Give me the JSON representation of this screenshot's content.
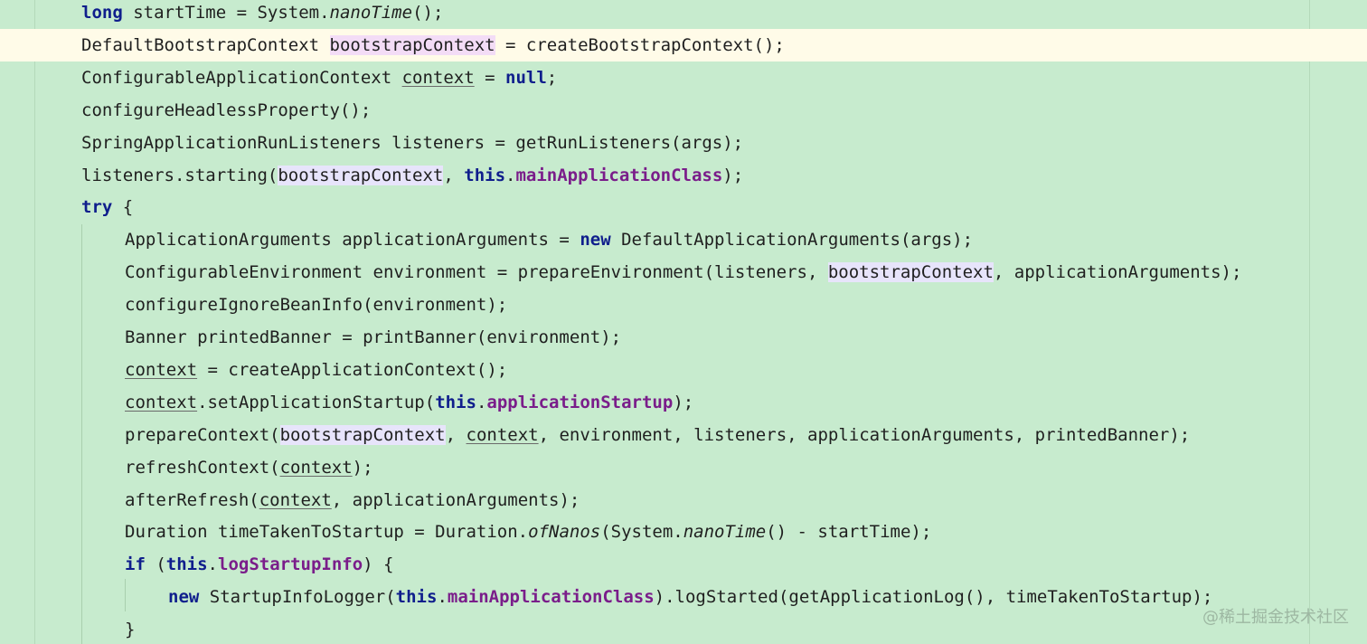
{
  "editor": {
    "lines": [
      {
        "indent": 1,
        "current": false,
        "tokens": [
          {
            "t": "long",
            "s": "kw"
          },
          {
            "t": " startTime = System."
          },
          {
            "t": "nanoTime",
            "s": "ital"
          },
          {
            "t": "();"
          }
        ]
      },
      {
        "indent": 1,
        "current": true,
        "tokens": [
          {
            "t": "DefaultBootstrapContext "
          },
          {
            "t": "bootstra",
            "s": "hl-caret"
          },
          {
            "caret": true
          },
          {
            "t": "pContext",
            "s": "hl-caret"
          },
          {
            "t": " = createBootstrapContext();"
          }
        ]
      },
      {
        "indent": 1,
        "current": false,
        "tokens": [
          {
            "t": "ConfigurableApplicationContext "
          },
          {
            "t": "context",
            "s": "ul"
          },
          {
            "t": " = "
          },
          {
            "t": "null",
            "s": "kw"
          },
          {
            "t": ";"
          }
        ]
      },
      {
        "indent": 1,
        "current": false,
        "tokens": [
          {
            "t": "configureHeadlessProperty();"
          }
        ]
      },
      {
        "indent": 1,
        "current": false,
        "tokens": [
          {
            "t": "SpringApplicationRunListeners listeners = getRunListeners(args);"
          }
        ]
      },
      {
        "indent": 1,
        "current": false,
        "tokens": [
          {
            "t": "listeners.starting("
          },
          {
            "t": "bootstrapContext",
            "s": "hl"
          },
          {
            "t": ", "
          },
          {
            "t": "this",
            "s": "kw"
          },
          {
            "t": "."
          },
          {
            "t": "mainApplicationClass",
            "s": "fld"
          },
          {
            "t": ");"
          }
        ]
      },
      {
        "indent": 1,
        "current": false,
        "tokens": [
          {
            "t": "try",
            "s": "kw"
          },
          {
            "t": " {"
          }
        ]
      },
      {
        "indent": 2,
        "current": false,
        "tokens": [
          {
            "t": "ApplicationArguments applicationArguments = "
          },
          {
            "t": "new",
            "s": "kw"
          },
          {
            "t": " DefaultApplicationArguments(args);"
          }
        ]
      },
      {
        "indent": 2,
        "current": false,
        "tokens": [
          {
            "t": "ConfigurableEnvironment environment = prepareEnvironment(listeners, "
          },
          {
            "t": "bootstrapContext",
            "s": "hl"
          },
          {
            "t": ", applicationArguments);"
          }
        ]
      },
      {
        "indent": 2,
        "current": false,
        "tokens": [
          {
            "t": "configureIgnoreBeanInfo(environment);"
          }
        ]
      },
      {
        "indent": 2,
        "current": false,
        "tokens": [
          {
            "t": "Banner printedBanner = printBanner(environment);"
          }
        ]
      },
      {
        "indent": 2,
        "current": false,
        "tokens": [
          {
            "t": "context",
            "s": "ul"
          },
          {
            "t": " = createApplicationContext();"
          }
        ]
      },
      {
        "indent": 2,
        "current": false,
        "tokens": [
          {
            "t": "context",
            "s": "ul"
          },
          {
            "t": ".setApplicationStartup("
          },
          {
            "t": "this",
            "s": "kw"
          },
          {
            "t": "."
          },
          {
            "t": "applicationStartup",
            "s": "fld"
          },
          {
            "t": ");"
          }
        ]
      },
      {
        "indent": 2,
        "current": false,
        "tokens": [
          {
            "t": "prepareContext("
          },
          {
            "t": "bootstrapContext",
            "s": "hl"
          },
          {
            "t": ", "
          },
          {
            "t": "context",
            "s": "ul"
          },
          {
            "t": ", environment, listeners, applicationArguments, printedBanner);"
          }
        ]
      },
      {
        "indent": 2,
        "current": false,
        "tokens": [
          {
            "t": "refreshContext("
          },
          {
            "t": "context",
            "s": "ul"
          },
          {
            "t": ");"
          }
        ]
      },
      {
        "indent": 2,
        "current": false,
        "tokens": [
          {
            "t": "afterRefresh("
          },
          {
            "t": "context",
            "s": "ul"
          },
          {
            "t": ", applicationArguments);"
          }
        ]
      },
      {
        "indent": 2,
        "current": false,
        "tokens": [
          {
            "t": "Duration timeTakenToStartup = Duration."
          },
          {
            "t": "ofNanos",
            "s": "ital"
          },
          {
            "t": "(System."
          },
          {
            "t": "nanoTime",
            "s": "ital"
          },
          {
            "t": "() - startTime);"
          }
        ]
      },
      {
        "indent": 2,
        "current": false,
        "tokens": [
          {
            "t": "if",
            "s": "kw"
          },
          {
            "t": " ("
          },
          {
            "t": "this",
            "s": "kw"
          },
          {
            "t": "."
          },
          {
            "t": "logStartupInfo",
            "s": "fld"
          },
          {
            "t": ") {"
          }
        ]
      },
      {
        "indent": 3,
        "current": false,
        "tokens": [
          {
            "t": "new",
            "s": "kw"
          },
          {
            "t": " StartupInfoLogger("
          },
          {
            "t": "this",
            "s": "kw"
          },
          {
            "t": "."
          },
          {
            "t": "mainApplicationClass",
            "s": "fld"
          },
          {
            "t": ").logStarted(getApplicationLog(), timeTakenToStartup);"
          }
        ]
      },
      {
        "indent": 2,
        "current": false,
        "tokens": [
          {
            "t": "}"
          }
        ]
      }
    ]
  },
  "watermark": "@稀土掘金技术社区"
}
